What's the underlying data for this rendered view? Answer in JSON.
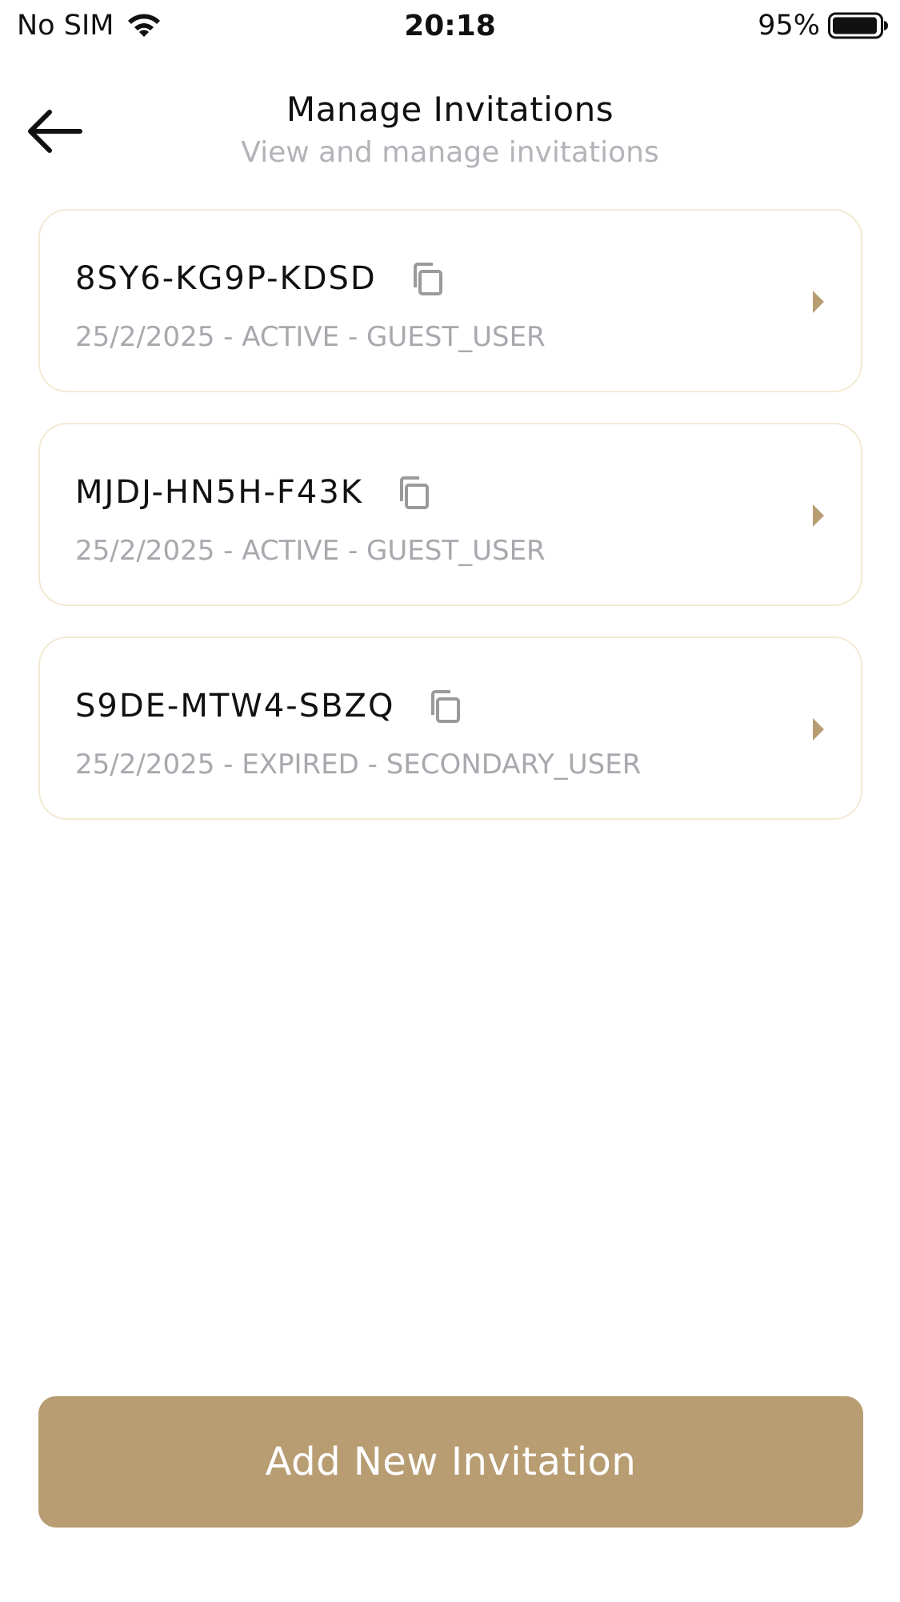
{
  "status_bar": {
    "carrier": "No SIM",
    "time": "20:18",
    "battery": "95%"
  },
  "header": {
    "title": "Manage Invitations",
    "subtitle": "View and manage invitations"
  },
  "invitations": [
    {
      "code": "8SY6-KG9P-KDSD",
      "meta": "25/2/2025 - ACTIVE - GUEST_USER"
    },
    {
      "code": "MJDJ-HN5H-F43K",
      "meta": "25/2/2025 - ACTIVE - GUEST_USER"
    },
    {
      "code": "S9DE-MTW4-SBZQ",
      "meta": "25/2/2025 - EXPIRED - SECONDARY_USER"
    }
  ],
  "actions": {
    "add_label": "Add New Invitation"
  },
  "colors": {
    "accent": "#b89d73",
    "card_border": "#f3ead4",
    "muted_text": "#a8a8ae"
  }
}
